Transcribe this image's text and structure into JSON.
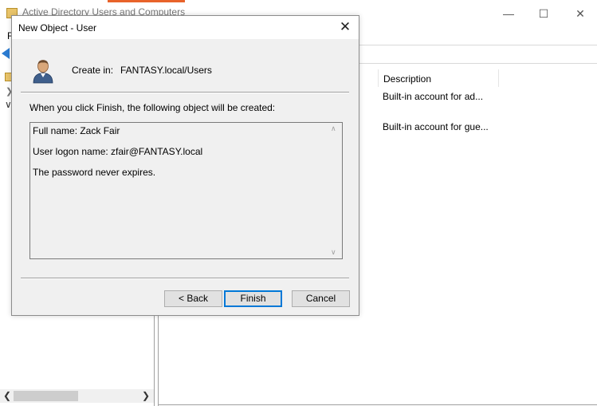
{
  "main_window": {
    "title": "Active Directory Users and Computers",
    "menu_first_letter": "F",
    "list": {
      "column_header": "Description",
      "rows": [
        "Built-in account for ad...",
        "Built-in account for gue..."
      ]
    }
  },
  "dialog": {
    "title": "New Object - User",
    "create_in_label": "Create in:",
    "create_in_value": "FANTASY.local/Users",
    "summary_intro": "When you click Finish, the following object will be created:",
    "summary_lines": [
      "Full name: Zack Fair",
      "User logon name: zfair@FANTASY.local",
      "The password never expires."
    ],
    "buttons": {
      "back": "< Back",
      "finish": "Finish",
      "cancel": "Cancel"
    }
  },
  "icons": [
    "user-icon",
    "close-icon",
    "back-arrow-icon",
    "folder-icon"
  ],
  "colors": {
    "accent": "#e8632a",
    "focus": "#0078d7",
    "dialog_bg": "#f0f0f0"
  }
}
